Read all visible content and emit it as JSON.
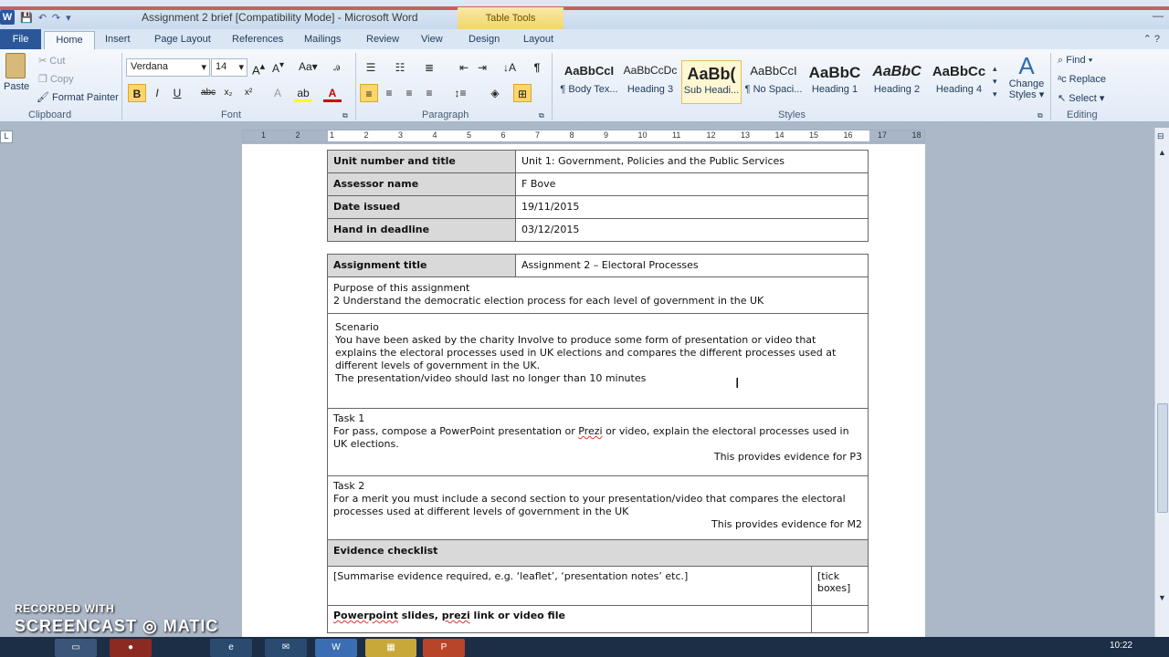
{
  "window": {
    "title": "Assignment 2 brief [Compatibility Mode] - Microsoft Word",
    "context_tab_group": "Table Tools"
  },
  "ribbon_tabs": [
    "File",
    "Home",
    "Insert",
    "Page Layout",
    "References",
    "Mailings",
    "Review",
    "View",
    "Design",
    "Layout"
  ],
  "clipboard": {
    "paste": "Paste",
    "cut": "Cut",
    "copy": "Copy",
    "format_painter": "Format Painter",
    "label": "Clipboard"
  },
  "font": {
    "name": "Verdana",
    "size": "14",
    "label": "Font"
  },
  "paragraph": {
    "label": "Paragraph"
  },
  "styles": {
    "label": "Styles",
    "items": [
      {
        "sample": "AaBbCcI",
        "name": "¶ Body Tex..."
      },
      {
        "sample": "AaBbCcDc",
        "name": "Heading 3"
      },
      {
        "sample": "AaBb(",
        "name": "Sub Headi..."
      },
      {
        "sample": "AaBbCcI",
        "name": "¶ No Spaci..."
      },
      {
        "sample": "AaBbC",
        "name": "Heading 1"
      },
      {
        "sample": "AaBbC",
        "name": "Heading 2"
      },
      {
        "sample": "AaBbCc",
        "name": "Heading 4"
      }
    ],
    "change_styles": "Change Styles"
  },
  "editing": {
    "find": "Find",
    "replace": "Replace",
    "select": "Select",
    "label": "Editing"
  },
  "ruler_numbers": [
    "1",
    "2",
    "1",
    "2",
    "3",
    "4",
    "5",
    "6",
    "7",
    "8",
    "9",
    "10",
    "11",
    "12",
    "13",
    "14",
    "15",
    "16",
    "17",
    "18"
  ],
  "document": {
    "info_table": [
      {
        "label": "Unit number and title",
        "value": "Unit 1: Government, Policies and the Public Services"
      },
      {
        "label": "Assessor name",
        "value": "F Bove"
      },
      {
        "label": "Date issued",
        "value": "19/11/2015"
      },
      {
        "label": "Hand in deadline",
        "value": "03/12/2015"
      }
    ],
    "assignment_title_label": "Assignment title",
    "assignment_title_value": "Assignment 2 – Electoral Processes",
    "purpose_heading": "Purpose of this assignment",
    "purpose_text": "2 Understand the democratic election process for each level of government in the UK",
    "scenario_heading": "Scenario",
    "scenario_text": "You have been asked by the charity Involve to produce some form of presentation or video that explains the electoral processes used in UK elections and compares the different processes used at different levels of government in the UK.",
    "scenario_text2": "The presentation/video should last no longer than 10 minutes",
    "task1_heading": "Task 1",
    "task1_pre": "For pass, compose a PowerPoint presentation or ",
    "task1_spell": "Prezi",
    "task1_post": " or video, explain the electoral processes used in UK elections.",
    "task1_evidence": "This provides evidence for P3",
    "task2_heading": "Task 2",
    "task2_text": "For a merit you must include a second section to your presentation/video that compares the electoral processes used at different levels of government in the UK",
    "task2_evidence": "This provides evidence for M2",
    "evidence_heading": "Evidence checklist",
    "evidence_row": "[Summarise evidence required, e.g. ‘leaflet’, ‘presentation notes’ etc.]",
    "tick_boxes": "[tick boxes]",
    "ppt_spell": "Powerpoint",
    "ppt_mid": " slides, ",
    "ppt_spell2": "prezi",
    "ppt_post": " link or video file"
  },
  "taskbar": {
    "clock": "10:22"
  },
  "watermark": {
    "line1": "RECORDED WITH",
    "line2": "SCREENCAST ◎ MATIC"
  }
}
